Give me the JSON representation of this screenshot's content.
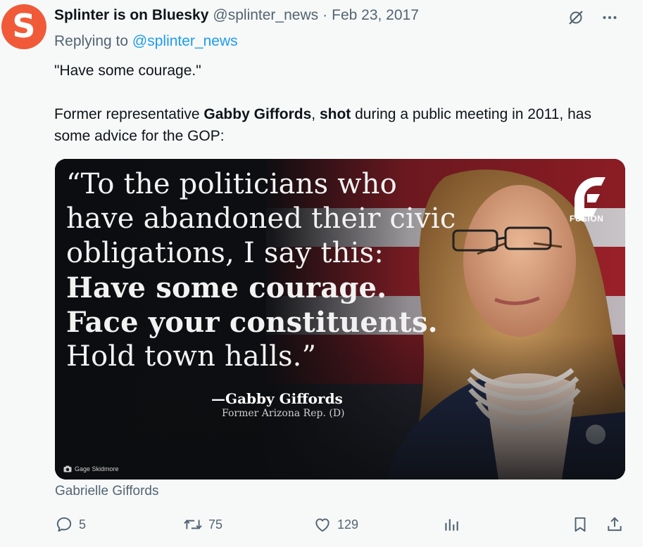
{
  "colors": {
    "avatar_bg": "#f15a38",
    "link": "#1d9bf0",
    "muted": "#536471",
    "text": "#0f1419",
    "background": "#f7f9f9"
  },
  "author": {
    "avatar_letter": "S",
    "display_name": "Splinter is on Bluesky",
    "handle": "@splinter_news",
    "separator": "·",
    "date": "Feb 23, 2017"
  },
  "top_icons": [
    "grok-icon",
    "more-icon"
  ],
  "replying": {
    "prefix": "Replying to",
    "handle": "@splinter_news"
  },
  "tweet": {
    "line1": "\"Have some courage.\"",
    "p2_a": "Former representative ",
    "p2_b": "Gabby Giffords",
    "p2_c": ", ",
    "p2_d": "shot",
    "p2_e": " during a public meeting in 2011, has some advice for the GOP:"
  },
  "media": {
    "quote_lines": [
      "“To the politicians who",
      "have abandoned their civic",
      "obligations, I say this:"
    ],
    "quote_bold": [
      "Have some courage.",
      "Face your constituents."
    ],
    "quote_last": "Hold town halls.”",
    "attribution": "—Gabby Giffords",
    "attribution_sub": "Former Arizona Rep. (D)",
    "photo_credit": "Gage Skidmore",
    "logo_text": "FUSION"
  },
  "caption": "Gabrielle Giffords",
  "actions": {
    "replies": "5",
    "reposts": "75",
    "likes": "129"
  }
}
